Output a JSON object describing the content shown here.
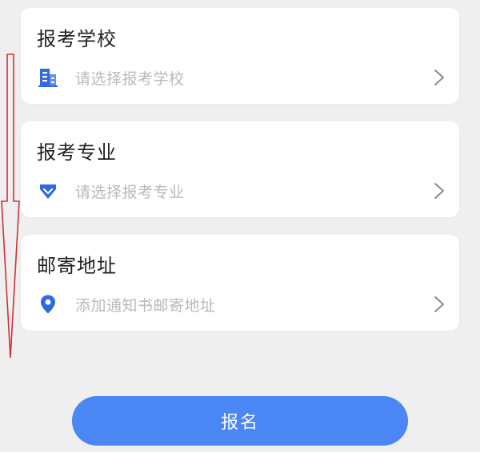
{
  "colors": {
    "background": "#efefef",
    "card": "#ffffff",
    "accent": "#2f6ae0",
    "placeholder": "#b9b9b9",
    "annotation": "#d0303a",
    "button": "#4a86f4"
  },
  "school": {
    "title": "报考学校",
    "placeholder": "请选择报考学校",
    "icon": "building-icon"
  },
  "major": {
    "title": "报考专业",
    "placeholder": "请选择报考专业",
    "icon": "diamond-icon"
  },
  "address": {
    "title": "邮寄地址",
    "placeholder": "添加通知书邮寄地址",
    "icon": "location-pin-icon"
  },
  "submit": {
    "label": "报名"
  }
}
